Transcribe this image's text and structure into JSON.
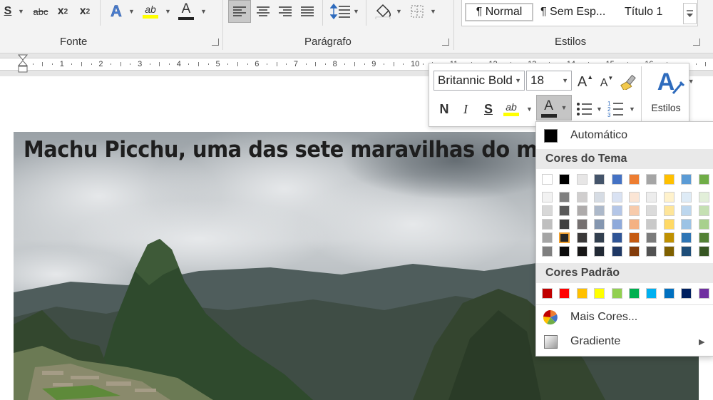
{
  "ribbon": {
    "font_group_label": "Fonte",
    "paragraph_group_label": "Parágrafo",
    "styles_group_label": "Estilos",
    "font_buttons": {
      "strikethrough": "abc",
      "subscript": "x",
      "subscript_index": "2",
      "superscript": "x",
      "superscript_index": "2",
      "text_effects": "A",
      "highlight": "ab",
      "font_color": "A"
    },
    "styles": [
      "¶ Normal",
      "¶ Sem Esp...",
      "Título 1"
    ]
  },
  "ruler": {
    "numbers": [
      "1",
      "2",
      "3",
      "4",
      "5",
      "6",
      "7",
      "8",
      "9",
      "10",
      "11",
      "12",
      "13",
      "14",
      "15",
      "16"
    ]
  },
  "document": {
    "image_title": "Machu Picchu, uma das sete maravilhas do mundo"
  },
  "mini_toolbar": {
    "font_name": "Britannic Bold",
    "font_size": "18",
    "grow_font": "A",
    "shrink_font": "A",
    "bold": "N",
    "italic": "I",
    "underline": "S",
    "highlight": "ab",
    "font_color": "A",
    "styles_label": "Estilos",
    "styles_icon": "A"
  },
  "color_palette": {
    "automatic_label": "Automático",
    "theme_colors_header": "Cores do Tema",
    "standard_colors_header": "Cores Padrão",
    "more_colors_label": "Mais Cores...",
    "gradient_label": "Gradiente",
    "theme_colors_top": [
      "#ffffff",
      "#000000",
      "#e7e6e6",
      "#44546a",
      "#4472c4",
      "#ed7d31",
      "#a5a5a5",
      "#ffc000",
      "#5b9bd5",
      "#70ad47"
    ],
    "theme_shades": [
      [
        "#f2f2f2",
        "#7f7f7f",
        "#d0cece",
        "#d6dce4",
        "#d9e2f3",
        "#fbe5d5",
        "#ededed",
        "#fff2cc",
        "#deebf6",
        "#e2efd9"
      ],
      [
        "#d8d8d8",
        "#595959",
        "#aeabab",
        "#adb9ca",
        "#b4c6e7",
        "#f7cbac",
        "#dbdbdb",
        "#fee599",
        "#bdd7ee",
        "#c5e0b3"
      ],
      [
        "#bfbfbf",
        "#3f3f3f",
        "#757070",
        "#8496b0",
        "#8eaadb",
        "#f4b183",
        "#c9c9c9",
        "#ffd965",
        "#9cc3e5",
        "#a8d08d"
      ],
      [
        "#a5a5a5",
        "#262626",
        "#3a3838",
        "#323f4f",
        "#2f5496",
        "#c55a11",
        "#7b7b7b",
        "#bf9000",
        "#2e75b5",
        "#538135"
      ],
      [
        "#7f7f7f",
        "#0c0c0c",
        "#171616",
        "#222a35",
        "#1f3864",
        "#833c0b",
        "#525252",
        "#7f6000",
        "#1e4e79",
        "#375623"
      ]
    ],
    "standard_colors": [
      "#c00000",
      "#ff0000",
      "#ffc000",
      "#ffff00",
      "#92d050",
      "#00b050",
      "#00b0f0",
      "#0070c0",
      "#002060",
      "#7030a0"
    ],
    "selected_color": "#262626"
  }
}
